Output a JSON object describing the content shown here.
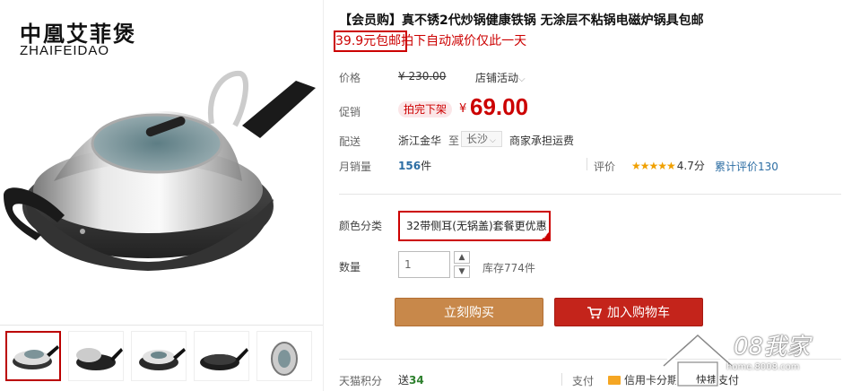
{
  "brand": {
    "name_cn": "中凰艾菲煲",
    "name_en": "ZHAIFEIDAO"
  },
  "product": {
    "title": "【会员购】真不锈2代炒锅健康铁锅 无涂层不粘锅电磁炉锅具包邮",
    "promo": "39.9元包邮拍下自动减价仅此一天"
  },
  "price": {
    "label": "价格",
    "original": "¥ 230.00",
    "activity": "店铺活动",
    "activity_icon": "chevron-down-icon"
  },
  "promotion": {
    "label": "促销",
    "badge": "拍完下架",
    "currency": "¥",
    "value": "69.00"
  },
  "shipping": {
    "label": "配送",
    "from": "浙江金华",
    "to_word": "至",
    "city": "长沙",
    "note": "商家承担运费"
  },
  "sales": {
    "label": "月销量",
    "count": "156",
    "unit": "件",
    "rating_label": "评价",
    "stars": "★★★★★",
    "score": "4.7分",
    "reviews": "累计评价130"
  },
  "color": {
    "label": "颜色分类",
    "selected": "32带侧耳(无锅盖)套餐更优惠"
  },
  "quantity": {
    "label": "数量",
    "value": "1",
    "stock": "库存774件",
    "up": "▲",
    "down": "▼"
  },
  "buttons": {
    "buy": "立刻购买",
    "cart": "加入购物车"
  },
  "footer": {
    "points_label": "天猫积分",
    "points_prefix": "送",
    "points_value": "34",
    "pay_label": "支付",
    "card_pay": "信用卡分期",
    "quick_pay": "快捷支付"
  },
  "watermark": {
    "text": "08我家",
    "url": "home.8008.com"
  },
  "colors": {
    "accent": "#c00000",
    "buy": "#c8884a",
    "cart": "#c4241b"
  }
}
